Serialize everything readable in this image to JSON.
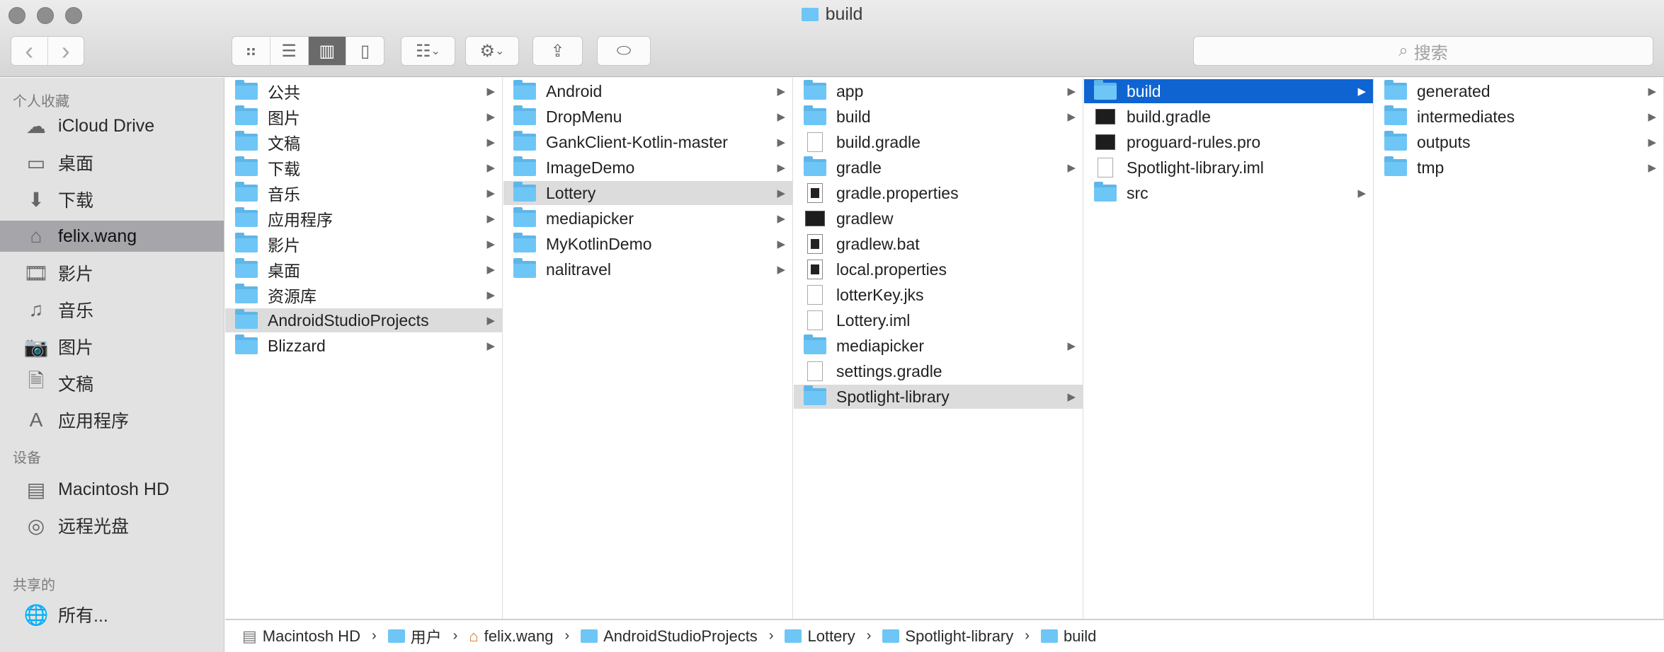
{
  "window": {
    "title": "build"
  },
  "toolbar": {
    "back": "‹",
    "forward": "›",
    "search_placeholder": "搜索"
  },
  "sidebar": {
    "sections": [
      {
        "header": "个人收藏",
        "items": [
          {
            "label": "iCloud Drive",
            "icon": "cloud-icon",
            "glyph": "☁"
          },
          {
            "label": "桌面",
            "icon": "desktop-icon",
            "glyph": "▭"
          },
          {
            "label": "下载",
            "icon": "download-icon",
            "glyph": "⬇"
          },
          {
            "label": "felix.wang",
            "icon": "home-icon",
            "glyph": "⌂",
            "selected": true
          },
          {
            "label": "影片",
            "icon": "film-icon",
            "glyph": "🎞"
          },
          {
            "label": "音乐",
            "icon": "music-icon",
            "glyph": "♫"
          },
          {
            "label": "图片",
            "icon": "camera-icon",
            "glyph": "📷"
          },
          {
            "label": "文稿",
            "icon": "document-icon",
            "glyph": "🗎"
          },
          {
            "label": "应用程序",
            "icon": "applications-icon",
            "glyph": "A"
          }
        ]
      },
      {
        "header": "设备",
        "items": [
          {
            "label": "Macintosh HD",
            "icon": "hard-drive-icon",
            "glyph": "▤"
          },
          {
            "label": "远程光盘",
            "icon": "disc-icon",
            "glyph": "◎"
          }
        ]
      },
      {
        "header": "共享的",
        "items": [
          {
            "label": "所有...",
            "icon": "network-icon",
            "glyph": "🌐"
          }
        ]
      }
    ]
  },
  "columns": [
    [
      {
        "n": "公共",
        "t": "folder",
        "a": 1
      },
      {
        "n": "图片",
        "t": "folder",
        "a": 1
      },
      {
        "n": "文稿",
        "t": "folder",
        "a": 1
      },
      {
        "n": "下载",
        "t": "folder",
        "a": 1
      },
      {
        "n": "音乐",
        "t": "folder",
        "a": 1
      },
      {
        "n": "应用程序",
        "t": "folder",
        "a": 1
      },
      {
        "n": "影片",
        "t": "folder",
        "a": 1
      },
      {
        "n": "桌面",
        "t": "folder",
        "a": 1
      },
      {
        "n": "资源库",
        "t": "folder",
        "a": 1
      },
      {
        "n": "AndroidStudioProjects",
        "t": "folder",
        "a": 1,
        "s": "gray"
      },
      {
        "n": "Blizzard",
        "t": "folder",
        "a": 1
      }
    ],
    [
      {
        "n": "Android",
        "t": "folder",
        "a": 1
      },
      {
        "n": "DropMenu",
        "t": "folder",
        "a": 1
      },
      {
        "n": "GankClient-Kotlin-master",
        "t": "folder",
        "a": 1
      },
      {
        "n": "ImageDemo",
        "t": "folder",
        "a": 1
      },
      {
        "n": "Lottery",
        "t": "folder",
        "a": 1,
        "s": "gray"
      },
      {
        "n": "mediapicker",
        "t": "folder",
        "a": 1
      },
      {
        "n": "MyKotlinDemo",
        "t": "folder",
        "a": 1
      },
      {
        "n": "nalitravel",
        "t": "folder",
        "a": 1
      }
    ],
    [
      {
        "n": "app",
        "t": "folder",
        "a": 1
      },
      {
        "n": "build",
        "t": "folder",
        "a": 1
      },
      {
        "n": "build.gradle",
        "t": "doc"
      },
      {
        "n": "gradle",
        "t": "folder",
        "a": 1
      },
      {
        "n": "gradle.properties",
        "t": "prop"
      },
      {
        "n": "gradlew",
        "t": "exec"
      },
      {
        "n": "gradlew.bat",
        "t": "prop"
      },
      {
        "n": "local.properties",
        "t": "prop"
      },
      {
        "n": "lotterKey.jks",
        "t": "doc"
      },
      {
        "n": "Lottery.iml",
        "t": "doc"
      },
      {
        "n": "mediapicker",
        "t": "folder",
        "a": 1
      },
      {
        "n": "settings.gradle",
        "t": "doc"
      },
      {
        "n": "Spotlight-library",
        "t": "folder",
        "a": 1,
        "s": "gray"
      }
    ],
    [
      {
        "n": "build",
        "t": "folder",
        "a": 1,
        "s": "blue"
      },
      {
        "n": "build.gradle",
        "t": "exec"
      },
      {
        "n": "proguard-rules.pro",
        "t": "exec"
      },
      {
        "n": "Spotlight-library.iml",
        "t": "doc"
      },
      {
        "n": "src",
        "t": "folder",
        "a": 1
      }
    ],
    [
      {
        "n": "generated",
        "t": "folder",
        "a": 1
      },
      {
        "n": "intermediates",
        "t": "folder",
        "a": 1
      },
      {
        "n": "outputs",
        "t": "folder",
        "a": 1
      },
      {
        "n": "tmp",
        "t": "folder",
        "a": 1
      }
    ]
  ],
  "pathbar": [
    "Macintosh HD",
    "用户",
    "felix.wang",
    "AndroidStudioProjects",
    "Lottery",
    "Spotlight-library",
    "build"
  ],
  "colors": {
    "selection_blue": "#0f64d2",
    "selection_gray": "#dcdcdc",
    "folder": "#6ec6f6"
  }
}
